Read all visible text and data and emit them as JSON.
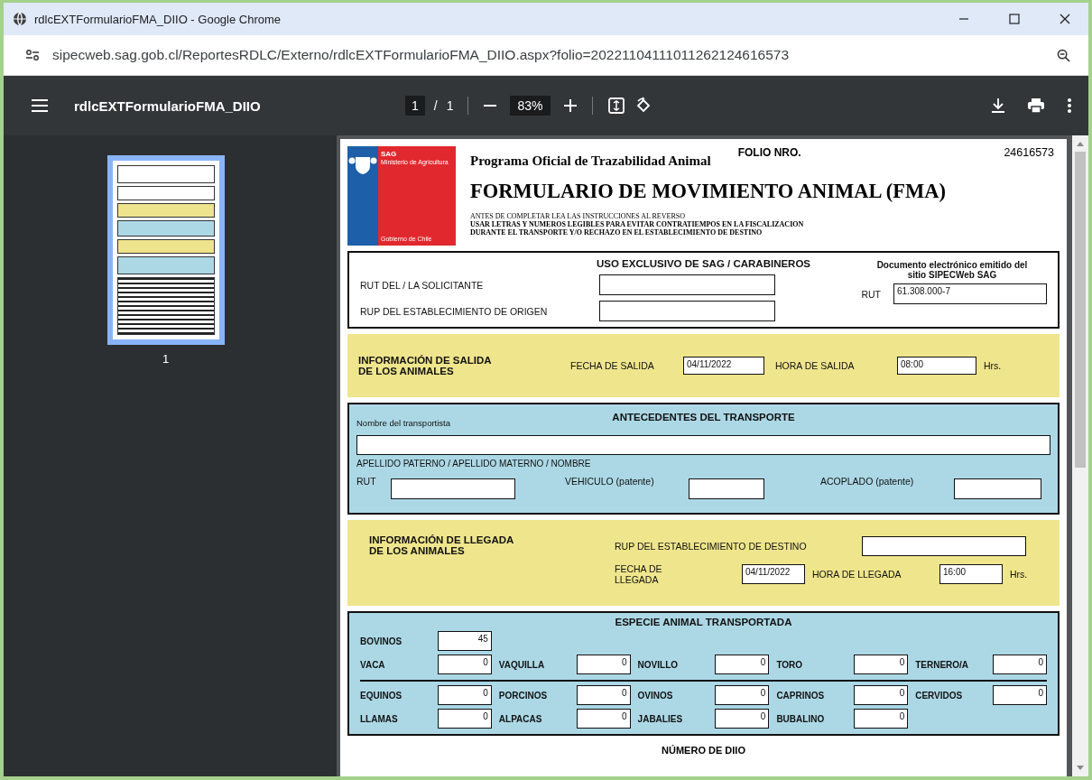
{
  "window": {
    "title": "rdlcEXTFormularioFMA_DIIO - Google Chrome"
  },
  "address_bar": {
    "url": "sipecweb.sag.gob.cl/ReportesRDLC/Externo/rdlcEXTFormularioFMA_DIIO.aspx?folio=20221104111011262124616573"
  },
  "pdf_toolbar": {
    "document_title": "rdlcEXTFormularioFMA_DIIO",
    "page_current": "1",
    "page_separator": "/",
    "page_total": "1",
    "zoom": "83%"
  },
  "sidebar": {
    "thumbnails": [
      {
        "label": "1",
        "selected": true
      }
    ]
  },
  "document": {
    "logo": {
      "agency": "SAG",
      "ministry": "Ministerio de Agricultura",
      "government": "Gobierno de Chile"
    },
    "program": "Programa Oficial de Trazabilidad Animal",
    "folio_label": "FOLIO NRO.",
    "folio": "24616573",
    "title": "FORMULARIO DE MOVIMIENTO ANIMAL (FMA)",
    "instructions": [
      {
        "text": "ANTES DE COMPLETAR LEA LAS INSTRUCCIONES AL REVERSO",
        "bold": false
      },
      {
        "text": "USAR LETRAS Y NUMEROS LEGIBLES PARA EVITAR CONTRATIEMPOS EN LA FISCALIZACION",
        "bold": true
      },
      {
        "text": "DURANTE EL TRANSPORTE Y/O RECHAZO EN EL ESTABLECIMIENTO DE DESTINO",
        "bold": true
      }
    ],
    "sag_use": {
      "title": "USO EXCLUSIVO DE SAG / CARABINEROS",
      "applicant_rut_label": "RUT DEL / LA SOLICITANTE",
      "origin_rup_label": "RUP DEL ESTABLECIMIENTO DE ORIGEN",
      "note": "Documento electrónico emitido del sitio SIPECWeb SAG",
      "rut_label": "RUT",
      "rut": "61.308.000-7"
    },
    "departure": {
      "title": "INFORMACIÓN DE SALIDA\nDE LOS ANIMALES",
      "date_label": "FECHA DE SALIDA",
      "date": "04/11/2022",
      "time_label": "HORA DE SALIDA",
      "time": "08:00",
      "unit": "Hrs."
    },
    "transport": {
      "title": "ANTECEDENTES DEL TRANSPORTE",
      "carrier_label": "Nombre del transportista",
      "name_caption": "APELLIDO PATERNO / APELLIDO MATERNO / NOMBRE",
      "rut_label": "RUT",
      "vehicle_label": "VEHICULO (patente)",
      "trailer_label": "ACOPLADO (patente)"
    },
    "arrival": {
      "title": "INFORMACIÓN DE LLEGADA\nDE LOS ANIMALES",
      "rup_label": "RUP DEL ESTABLECIMIENTO DE DESTINO",
      "date_label": "FECHA DE\nLLEGADA",
      "date": "04/11/2022",
      "time_label": "HORA DE LLEGADA",
      "time": "16:00",
      "unit": "Hrs."
    },
    "species": {
      "title": "ESPECIE ANIMAL TRANSPORTADA",
      "rows": [
        [
          {
            "label": "BOVINOS",
            "value": "45"
          }
        ],
        [
          {
            "label": "VACA",
            "value": "0"
          },
          {
            "label": "VAQUILLA",
            "value": "0"
          },
          {
            "label": "NOVILLO",
            "value": "0"
          },
          {
            "label": "TORO",
            "value": "0"
          },
          {
            "label": "TERNERO/A",
            "value": "0"
          }
        ],
        [
          {
            "label": "EQUINOS",
            "value": "0"
          },
          {
            "label": "PORCINOS",
            "value": "0"
          },
          {
            "label": "OVINOS",
            "value": "0"
          },
          {
            "label": "CAPRINOS",
            "value": "0"
          },
          {
            "label": "CERVIDOS",
            "value": "0"
          }
        ],
        [
          {
            "label": "LLAMAS",
            "value": "0"
          },
          {
            "label": "ALPACAS",
            "value": "0"
          },
          {
            "label": "JABALIES",
            "value": "0"
          },
          {
            "label": "BUBALINO",
            "value": "0"
          }
        ]
      ]
    },
    "next_section": "NÚMERO DE DIIO"
  }
}
